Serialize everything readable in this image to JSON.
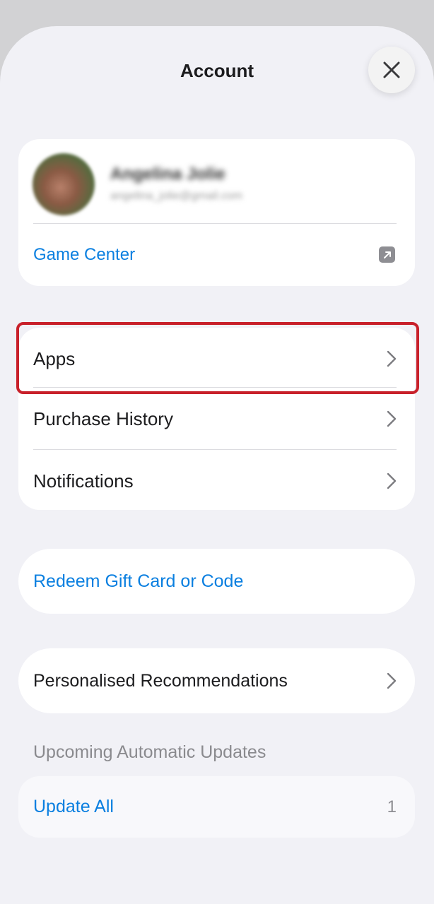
{
  "header": {
    "title": "Account"
  },
  "profile": {
    "name": "Angelina Jolie",
    "email": "angelina_jolie@gmail.com",
    "game_center_label": "Game Center"
  },
  "menu": {
    "items": [
      {
        "label": "Apps"
      },
      {
        "label": "Purchase History"
      },
      {
        "label": "Notifications"
      }
    ]
  },
  "redeem": {
    "label": "Redeem Gift Card or Code"
  },
  "recommendations": {
    "label": "Personalised Recommendations"
  },
  "updates": {
    "section_title": "Upcoming Automatic Updates",
    "update_all_label": "Update All",
    "count": "1"
  },
  "colors": {
    "accent": "#0a7fe0",
    "highlight": "#c8202a",
    "background": "#f1f1f6"
  },
  "icons": {
    "close": "close-icon",
    "external": "external-link-icon",
    "chevron": "chevron-right-icon"
  }
}
